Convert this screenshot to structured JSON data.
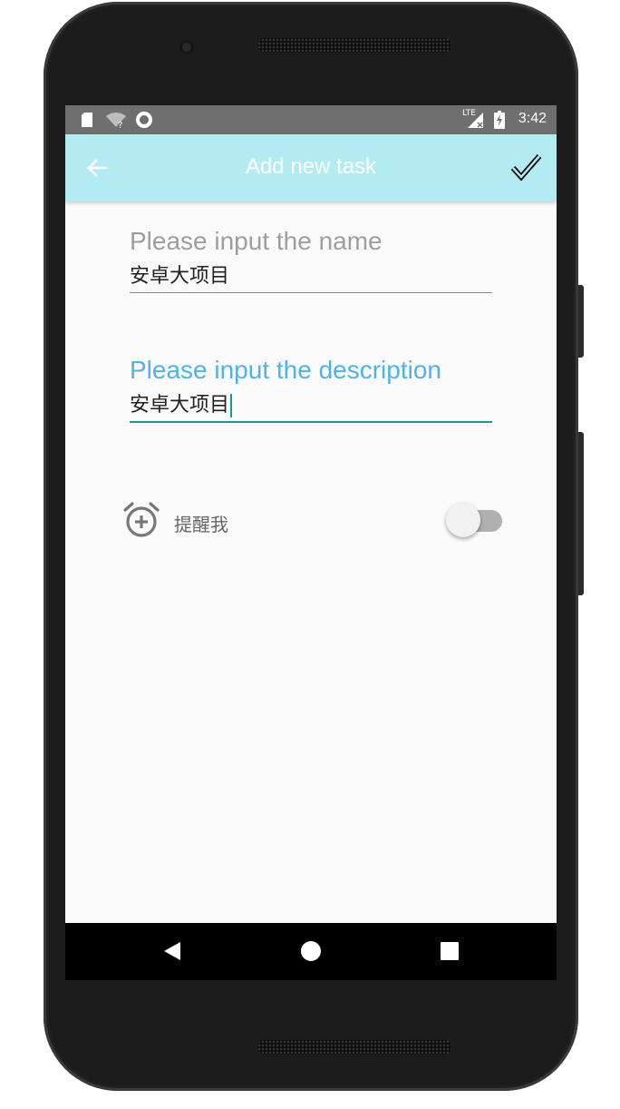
{
  "status_bar": {
    "time": "3:42",
    "network_label": "LTE",
    "icons": [
      "sd-card-icon",
      "wifi-unknown-icon",
      "sync-icon",
      "signal-icon",
      "battery-charging-icon"
    ]
  },
  "app_bar": {
    "title": "Add new task",
    "back_icon": "arrow-back-icon",
    "confirm_icon": "check-icon",
    "background": "#b3ebf3"
  },
  "form": {
    "name_field": {
      "hint": "Please input the name",
      "value": "安卓大项目",
      "hint_color": "#9e9e9e"
    },
    "description_field": {
      "hint": "Please input the description",
      "value": "安卓大项目",
      "hint_color": "#4fb3e8",
      "focused": true
    },
    "reminder": {
      "icon": "alarm-add-icon",
      "label": "提醒我",
      "enabled": false
    }
  },
  "nav_bar": {
    "buttons": [
      "back-triangle-icon",
      "home-circle-icon",
      "recents-square-icon"
    ]
  }
}
